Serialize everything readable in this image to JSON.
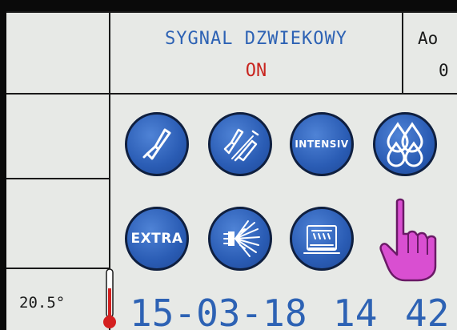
{
  "header": {
    "title": "SYGNAL DZWIEKOWY",
    "status": "ON",
    "corner_label": "Ao",
    "corner_value": "0"
  },
  "programs": [
    {
      "id": "program-1",
      "icon": "single-glass-icon"
    },
    {
      "id": "program-2",
      "icon": "glass-and-bottle-icon"
    },
    {
      "id": "program-3",
      "label": "INTENSIV"
    },
    {
      "id": "program-4",
      "icon": "water-drops-icon"
    },
    {
      "id": "program-5",
      "label": "EXTRA"
    },
    {
      "id": "program-6",
      "icon": "spray-burst-icon"
    },
    {
      "id": "program-7",
      "icon": "tray-heat-icon"
    }
  ],
  "footer": {
    "temperature": "20.5°",
    "date": "15-03-18",
    "hour": "14",
    "minute": "42"
  },
  "colors": {
    "screen_bg": "#e7e9e6",
    "accent_blue": "#2d62b4",
    "status_red": "#c8251f",
    "button_blue": "#2a5cb4",
    "pointer_magenta": "#d94fd1",
    "thermometer_red": "#d42020"
  }
}
